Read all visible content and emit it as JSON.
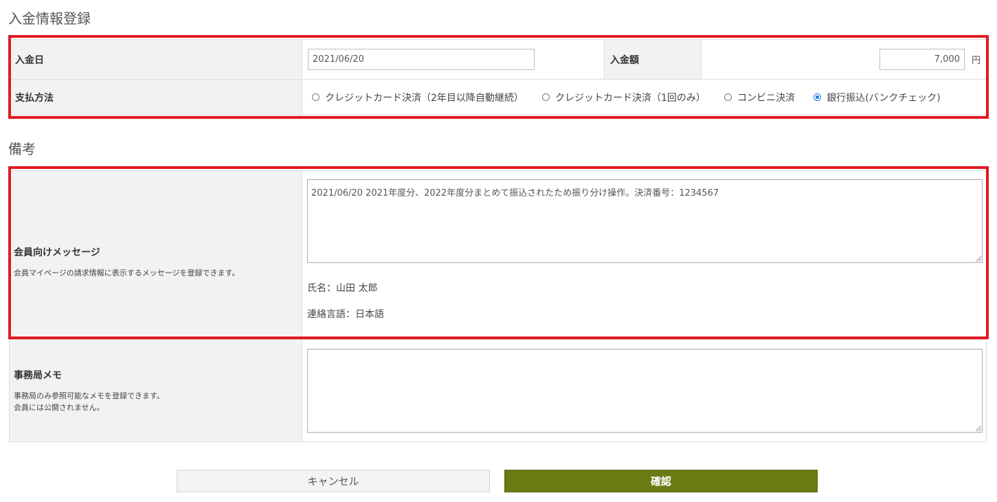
{
  "payment_section": {
    "title": "入金情報登録",
    "date_label": "入金日",
    "date_value": "2021/06/20",
    "amount_label": "入金額",
    "amount_value": "7,000",
    "amount_unit": "円",
    "method_label": "支払方法",
    "methods": [
      {
        "label": "クレジットカード決済（2年目以降自動継続）",
        "selected": false
      },
      {
        "label": "クレジットカード決済（1回のみ）",
        "selected": false
      },
      {
        "label": "コンビニ決済",
        "selected": false
      },
      {
        "label": "銀行振込(バンクチェック)",
        "selected": true
      }
    ]
  },
  "notes_section": {
    "title": "備考",
    "member_message_label": "会員向けメッセージ",
    "member_message_help": "会員マイページの請求情報に表示するメッセージを登録できます。",
    "member_message_value": "2021/06/20 2021年度分、2022年度分まとめて振込されたため振り分け操作。決済番号：1234567",
    "name_line": "氏名：山田 太郎",
    "language_line": "連絡言語：日本語",
    "office_memo_label": "事務局メモ",
    "office_memo_help_1": "事務局のみ参照可能なメモを登録できます。",
    "office_memo_help_2": "会員には公開されません。",
    "office_memo_value": ""
  },
  "buttons": {
    "cancel": "キャンセル",
    "confirm": "確認"
  },
  "colors": {
    "highlight": "#e01b24",
    "confirm_button": "#6b7a12",
    "label_background": "#f2f2f2"
  }
}
